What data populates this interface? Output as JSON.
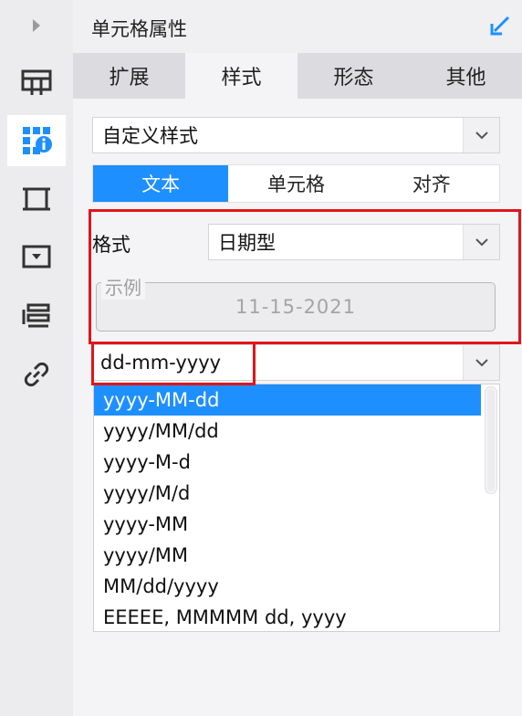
{
  "sidebar": {
    "items": [
      {
        "name": "frame-layout-icon"
      },
      {
        "name": "cell-properties-icon",
        "active": true
      },
      {
        "name": "crop-frame-icon"
      },
      {
        "name": "widget-dropdown-icon"
      },
      {
        "name": "stack-list-icon"
      },
      {
        "name": "link-icon"
      }
    ]
  },
  "panel": {
    "title": "单元格属性",
    "tabs": [
      "扩展",
      "样式",
      "形态",
      "其他"
    ],
    "active_tab": 1
  },
  "style_select": {
    "value": "自定义样式"
  },
  "segments": {
    "items": [
      "文本",
      "单元格",
      "对齐"
    ],
    "active": 0
  },
  "format": {
    "label": "格式",
    "type_value": "日期型",
    "example_label": "示例",
    "example_value": "11-15-2021",
    "pattern_value": "dd-mm-yyyy"
  },
  "dropdown": {
    "options": [
      "yyyy-MM-dd",
      "yyyy/MM/dd",
      "yyyy-M-d",
      "yyyy/M/d",
      "yyyy-MM",
      "yyyy/MM",
      "MM/dd/yyyy",
      "EEEEE, MMMMM dd, yyyy"
    ],
    "selected_index": 0
  },
  "colors": {
    "accent": "#1e8fff",
    "highlight": "#e0151b"
  }
}
